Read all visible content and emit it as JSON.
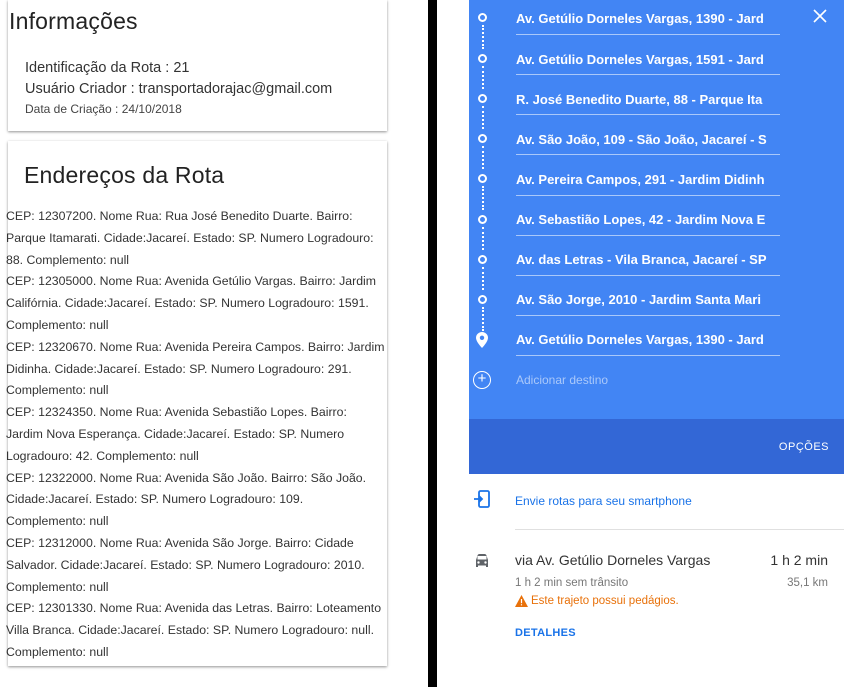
{
  "info": {
    "title": "Informações",
    "route_id": "Identificação da Rota : 21",
    "creator": "Usuário Criador : transportadorajac@gmail.com",
    "created": "Data de Criação : 24/10/2018"
  },
  "addresses": {
    "title": "Endereços da Rota",
    "items": [
      "CEP: 12307200. Nome Rua: Rua José Benedito Duarte. Bairro: Parque Itamarati. Cidade:Jacareí. Estado: SP. Numero Logradouro: 88. Complemento: null",
      "CEP: 12305000. Nome Rua: Avenida Getúlio Vargas. Bairro: Jardim Califórnia. Cidade:Jacareí. Estado: SP. Numero Logradouro: 1591. Complemento: null",
      "CEP: 12320670. Nome Rua: Avenida Pereira Campos. Bairro: Jardim Didinha. Cidade:Jacareí. Estado: SP. Numero Logradouro: 291. Complemento: null",
      "CEP: 12324350. Nome Rua: Avenida Sebastião Lopes. Bairro: Jardim Nova Esperança. Cidade:Jacareí. Estado: SP. Numero Logradouro: 42. Complemento: null",
      "CEP: 12322000. Nome Rua: Avenida São João. Bairro: São João. Cidade:Jacareí. Estado: SP. Numero Logradouro: 109. Complemento: null",
      "CEP: 12312000. Nome Rua: Avenida São Jorge. Bairro: Cidade Salvador. Cidade:Jacareí. Estado: SP. Numero Logradouro: 2010. Complemento: null",
      "CEP: 12301330. Nome Rua: Avenida das Letras. Bairro: Loteamento Villa Branca. Cidade:Jacareí. Estado: SP. Numero Logradouro: null. Complemento: null"
    ]
  },
  "directions": {
    "stops": [
      "Av. Getúlio Dorneles Vargas, 1390 - Jard",
      "Av. Getúlio Dorneles Vargas, 1591 - Jard",
      "R. José Benedito Duarte, 88 - Parque Ita",
      "Av. São João, 109 - São João, Jacareí - S",
      "Av. Pereira Campos, 291 - Jardim Didinh",
      "Av. Sebastião Lopes, 42 - Jardim Nova E",
      "Av. das Letras - Vila Branca, Jacareí - SP",
      "Av. São Jorge, 2010 - Jardim Santa Mari",
      "Av. Getúlio Dorneles Vargas, 1390 - Jard"
    ],
    "add_destination": "Adicionar destino",
    "options_label": "OPÇÕES",
    "send_to_phone": "Envie rotas para seu smartphone",
    "route_name": "via Av. Getúlio Dorneles Vargas",
    "route_time": "1 h 2 min",
    "route_sub": "1 h 2 min sem trânsito",
    "route_distance": "35,1 km",
    "toll_warning": "Este trajeto possui pedágios.",
    "details_label": "DETALHES"
  },
  "colors": {
    "panel_blue": "#4285f4",
    "panel_blue_dark": "#3367d6",
    "link_blue": "#1a73e8",
    "warning_orange": "#e8710a"
  },
  "icons": {
    "close": "close-icon",
    "stop": "waypoint-dot-icon",
    "destination": "map-pin-icon",
    "add": "add-circle-icon",
    "phone": "send-to-phone-icon",
    "car": "car-icon",
    "warning": "warning-icon"
  }
}
